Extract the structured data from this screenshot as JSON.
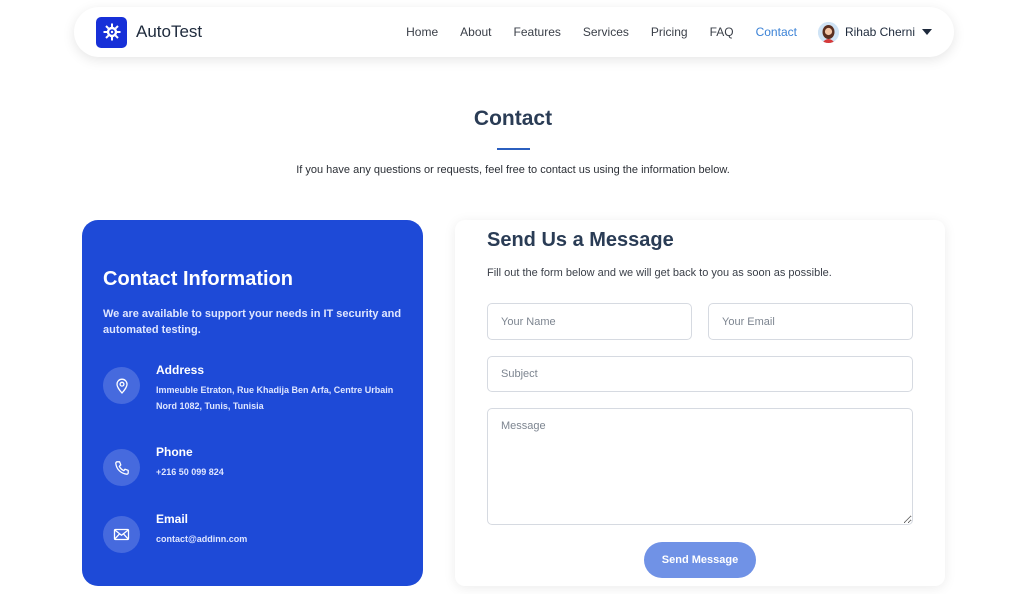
{
  "brand": {
    "name": "AutoTest",
    "logo_icon": "gear-bug-icon",
    "accent": "#1730d8"
  },
  "nav": {
    "links": [
      {
        "label": "Home"
      },
      {
        "label": "About"
      },
      {
        "label": "Features"
      },
      {
        "label": "Services"
      },
      {
        "label": "Pricing"
      },
      {
        "label": "FAQ"
      },
      {
        "label": "Contact",
        "active": true
      }
    ],
    "active_color": "#3b82d6",
    "user": {
      "name": "Rihab Cherni",
      "avatar_icon": "avatar",
      "menu_icon": "caret-down-icon"
    }
  },
  "heading": {
    "title": "Contact",
    "subtitle": "If you have any questions or requests, feel free to contact us using the information below."
  },
  "info": {
    "title": "Contact Information",
    "description": "We are available to support your needs in IT security and automated testing.",
    "card_color": "#1e4ad7",
    "items": [
      {
        "icon": "location-pin-icon",
        "label": "Address",
        "value": "Immeuble Etraton, Rue Khadija Ben Arfa, Centre Urbain Nord 1082, Tunis, Tunisia"
      },
      {
        "icon": "phone-icon",
        "label": "Phone",
        "value": "+216 50 099 824"
      },
      {
        "icon": "envelope-icon",
        "label": "Email",
        "value": "contact@addinn.com"
      }
    ]
  },
  "form": {
    "title": "Send Us a Message",
    "subtitle": "Fill out the form below and we will get back to you as soon as possible.",
    "name_placeholder": "Your Name",
    "email_placeholder": "Your Email",
    "subject_placeholder": "Subject",
    "message_placeholder": "Message",
    "submit_label": "Send Message",
    "button_color": "#7092e6"
  }
}
